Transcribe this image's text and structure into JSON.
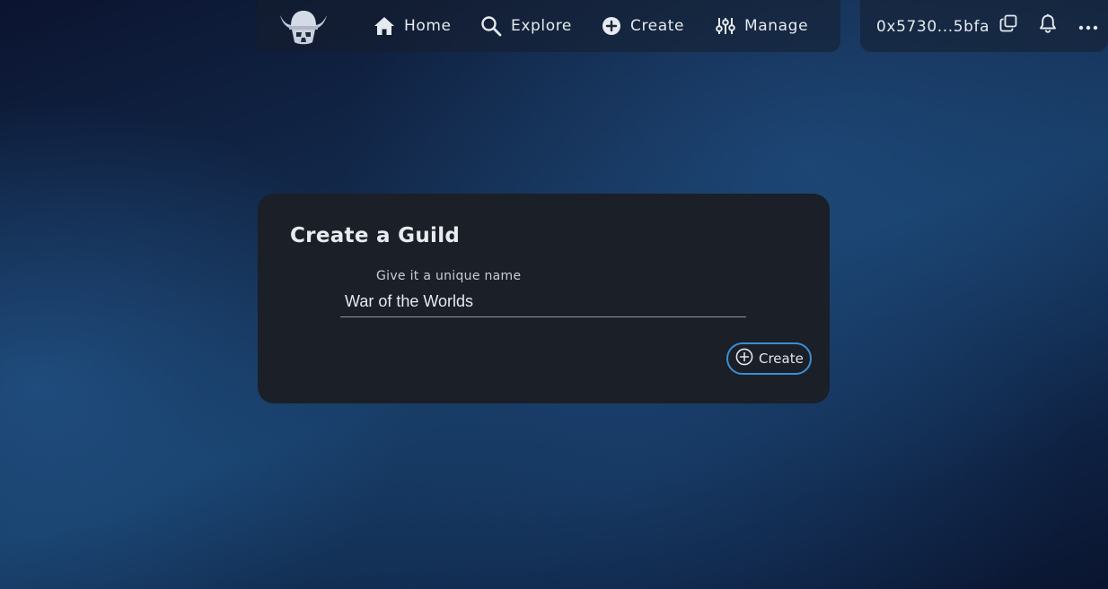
{
  "nav": {
    "logo_icon": "viking-helmet-logo-icon",
    "items": [
      {
        "label": "Home",
        "icon": "home-icon"
      },
      {
        "label": "Explore",
        "icon": "search-icon"
      },
      {
        "label": "Create",
        "icon": "plus-circle-icon"
      },
      {
        "label": "Manage",
        "icon": "sliders-icon"
      }
    ]
  },
  "wallet": {
    "address": "0x5730...5bfa",
    "copy_icon": "copy-icon",
    "bell_icon": "bell-icon",
    "more_icon": "more-horizontal-icon"
  },
  "form": {
    "title": "Create a Guild",
    "name_label": "Give it a unique name",
    "name_value": "War of the Worlds",
    "submit_label": "Create",
    "submit_icon": "plus-circle-outline-icon"
  },
  "colors": {
    "card_background": "#1b1f27",
    "accent": "#3a8fd6",
    "text": "#e6eaf0"
  }
}
